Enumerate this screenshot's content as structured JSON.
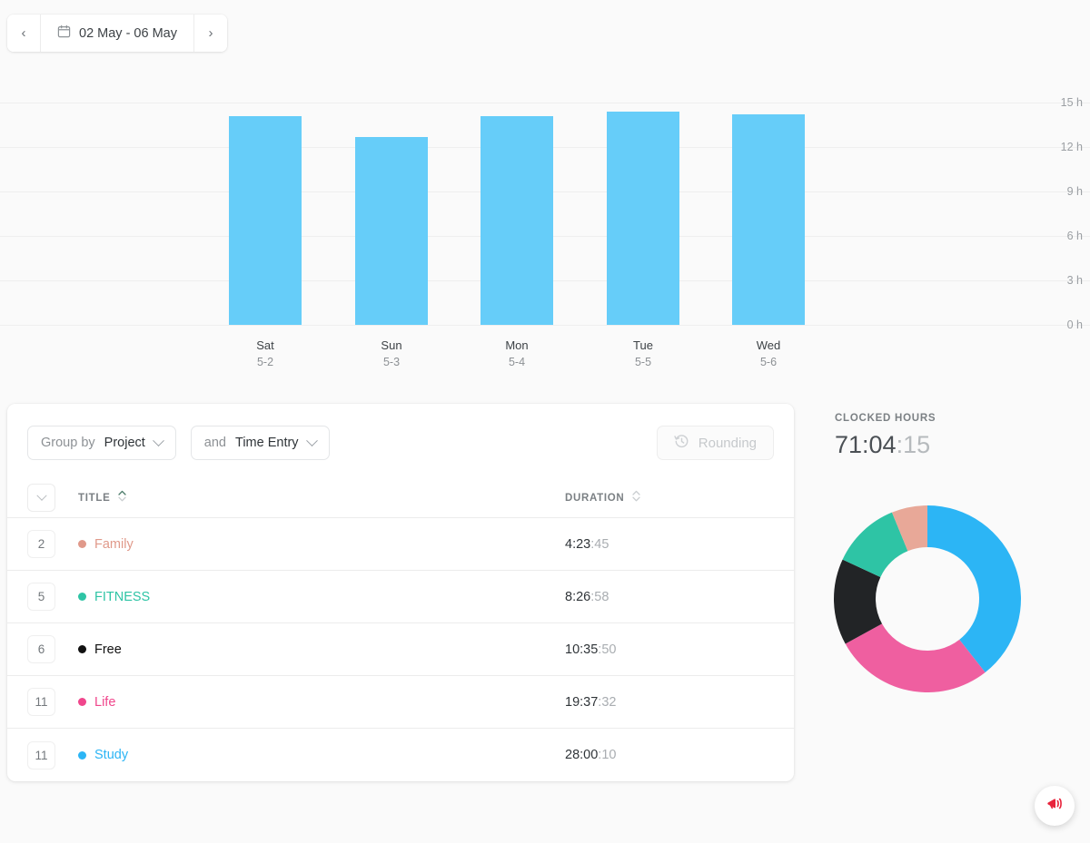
{
  "date_nav": {
    "prev_label": "‹",
    "next_label": "›",
    "range_label": "02 May - 06 May",
    "calendar_icon": "calendar-icon"
  },
  "chart_data": {
    "type": "bar",
    "title": "",
    "xlabel": "",
    "ylabel": "",
    "categories": [
      "Sat",
      "Sun",
      "Mon",
      "Tue",
      "Wed"
    ],
    "category_dates": [
      "5-2",
      "5-3",
      "5-4",
      "5-5",
      "5-6"
    ],
    "values": [
      14.1,
      12.7,
      14.1,
      14.4,
      14.2
    ],
    "ylim": [
      0,
      15
    ],
    "yticks": [
      0,
      3,
      6,
      9,
      12,
      15
    ],
    "ytick_labels": [
      "0 h",
      "3 h",
      "6 h",
      "9 h",
      "12 h",
      "15 h"
    ],
    "grid": true,
    "legend": "none",
    "bar_color": "#66cdf9"
  },
  "toolbar": {
    "group_by_prefix": "Group by",
    "group_by_value": "Project",
    "secondary_prefix": "and",
    "secondary_value": "Time Entry",
    "rounding_label": "Rounding",
    "rounding_icon": "history-clock-icon",
    "rounding_disabled": true
  },
  "table": {
    "columns": {
      "title": "TITLE",
      "duration": "DURATION"
    },
    "rows": [
      {
        "count": "2",
        "project": "Family",
        "color": "#e0998a",
        "duration_main": "4:23",
        "duration_sec": ":45"
      },
      {
        "count": "5",
        "project": "FITNESS",
        "color": "#2ec4a5",
        "duration_main": "8:26",
        "duration_sec": ":58"
      },
      {
        "count": "6",
        "project": "Free",
        "color": "#111111",
        "duration_main": "10:35",
        "duration_sec": ":50"
      },
      {
        "count": "11",
        "project": "Life",
        "color": "#f0468c",
        "duration_main": "19:37",
        "duration_sec": ":32"
      },
      {
        "count": "11",
        "project": "Study",
        "color": "#2cb5f5",
        "duration_main": "28:00",
        "duration_sec": ":10"
      }
    ]
  },
  "summary": {
    "label": "CLOCKED HOURS",
    "total_main": "71:04",
    "total_sec": ":15",
    "donut": {
      "type": "pie",
      "segments": [
        {
          "name": "Study",
          "value": 28.003,
          "percent": 39.4,
          "color": "#2cb5f5"
        },
        {
          "name": "Life",
          "value": 19.626,
          "percent": 27.6,
          "color": "#ef5fa0"
        },
        {
          "name": "Free",
          "value": 10.597,
          "percent": 14.9,
          "color": "#222426"
        },
        {
          "name": "FITNESS",
          "value": 8.449,
          "percent": 11.9,
          "color": "#2ec4a5"
        },
        {
          "name": "Family",
          "value": 4.396,
          "percent": 6.2,
          "color": "#e8a898"
        }
      ]
    }
  },
  "fab": {
    "icon": "megaphone-icon",
    "color": "#e8243c"
  }
}
